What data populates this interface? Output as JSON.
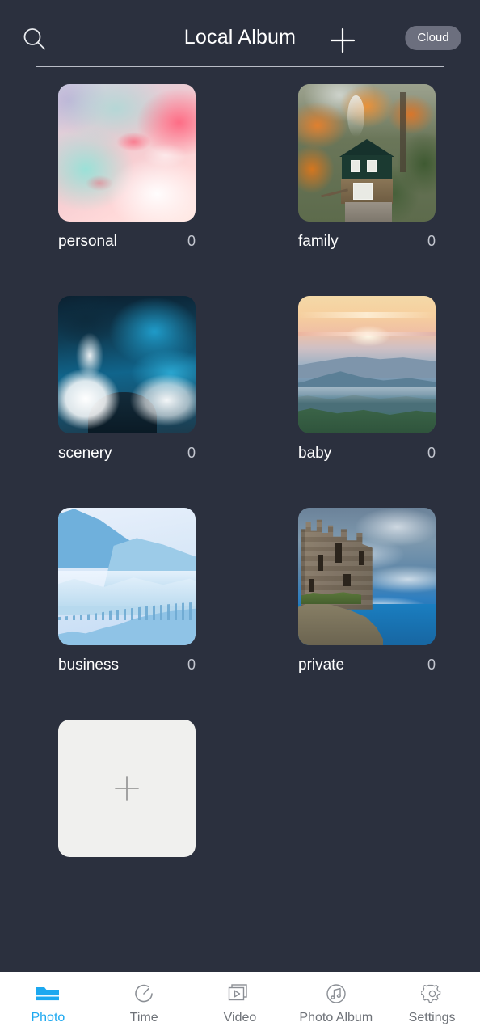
{
  "header": {
    "title": "Local Album",
    "search_icon": "search-icon",
    "add_icon": "plus-icon",
    "cloud_label": "Cloud"
  },
  "albums": [
    {
      "name": "personal",
      "count": "0",
      "art": "pink-teal-abstract-swirl"
    },
    {
      "name": "family",
      "count": "0",
      "art": "autumn-cabin-forest"
    },
    {
      "name": "scenery",
      "count": "0",
      "art": "ocean-wave-crashing"
    },
    {
      "name": "baby",
      "count": "0",
      "art": "mountain-sunrise"
    },
    {
      "name": "business",
      "count": "0",
      "art": "misty-blue-mountains"
    },
    {
      "name": "private",
      "count": "0",
      "art": "castle-ruin-cliff"
    }
  ],
  "add_album": {
    "icon": "plus-icon"
  },
  "bottom_nav": {
    "active_color": "#1ca8f0",
    "inactive_color": "#6e7278",
    "items": [
      {
        "label": "Photo",
        "icon": "folder-icon",
        "active": true
      },
      {
        "label": "Time",
        "icon": "clock-icon",
        "active": false
      },
      {
        "label": "Video",
        "icon": "video-icon",
        "active": false
      },
      {
        "label": "Photo Album",
        "icon": "music-note-icon",
        "active": false
      },
      {
        "label": "Settings",
        "icon": "gear-icon",
        "active": false
      }
    ]
  },
  "theme": {
    "background": "#2b303e",
    "nav_background": "#ffffff",
    "text_primary": "#ffffff",
    "text_secondary": "#c3c6cf",
    "pill_background": "#6c6f7e",
    "add_tile_background": "#f0f0ee"
  }
}
